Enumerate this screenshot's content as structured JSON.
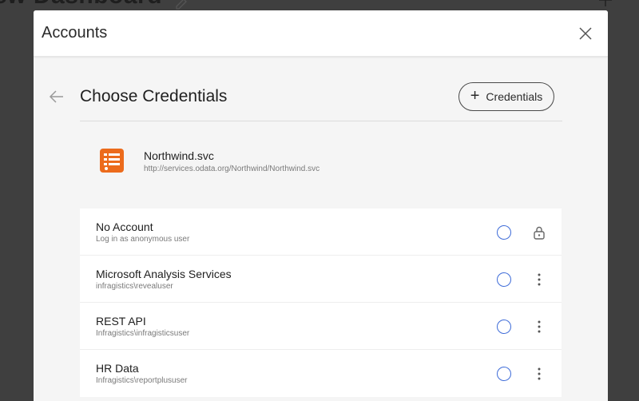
{
  "background": {
    "title": "ew Dashboard"
  },
  "modal": {
    "title": "Accounts",
    "section_title": "Choose Credentials",
    "add_credentials_label": "Credentials"
  },
  "source": {
    "name": "Northwind.svc",
    "url": "http://services.odata.org/Northwind/Northwind.svc",
    "icon": "odata-table-icon",
    "icon_color": "#ec6b1c"
  },
  "accounts": [
    {
      "name": "No Account",
      "sub": "Log in as anonymous user",
      "action_icon": "lock-icon"
    },
    {
      "name": "Microsoft Analysis Services",
      "sub": "infragistics\\revealuser",
      "action_icon": "more-vertical-icon"
    },
    {
      "name": "REST API",
      "sub": "Infragistics\\infragisticsuser",
      "action_icon": "more-vertical-icon"
    },
    {
      "name": "HR Data",
      "sub": "Infragistics\\reportplususer",
      "action_icon": "more-vertical-icon"
    }
  ],
  "colors": {
    "radio_accent": "#3d6bd8",
    "overlay": "#3f3f3f"
  }
}
